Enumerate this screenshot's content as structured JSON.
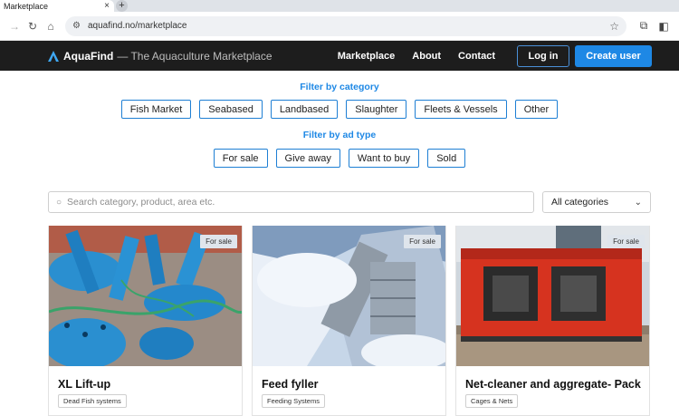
{
  "browser": {
    "tab_title": "Marketplace",
    "tab_close": "×",
    "new_tab": "+",
    "url": "aquafind.no/marketplace"
  },
  "header": {
    "brand": "AquaFind",
    "tagline": "— The Aquaculture Marketplace",
    "nav": [
      "Marketplace",
      "About",
      "Contact"
    ],
    "login": "Log in",
    "create_user": "Create user"
  },
  "filters": {
    "category_title": "Filter by category",
    "categories": [
      "Fish Market",
      "Seabased",
      "Landbased",
      "Slaughter",
      "Fleets & Vessels",
      "Other"
    ],
    "adtype_title": "Filter by ad type",
    "ad_types": [
      "For sale",
      "Give away",
      "Want to buy",
      "Sold"
    ]
  },
  "search": {
    "placeholder": "Search category, product, area etc.",
    "category_select": "All categories"
  },
  "listings": [
    {
      "badge": "For sale",
      "title": "XL Lift-up",
      "tag": "Dead Fish systems"
    },
    {
      "badge": "For sale",
      "title": "Feed fyller",
      "tag": "Feeding Systems"
    },
    {
      "badge": "For sale",
      "title": "Net-cleaner and aggregate- Pack",
      "tag": "Cages & Nets"
    }
  ],
  "colors": {
    "accent": "#1e88e5",
    "header_bg": "#1d1d1d"
  }
}
